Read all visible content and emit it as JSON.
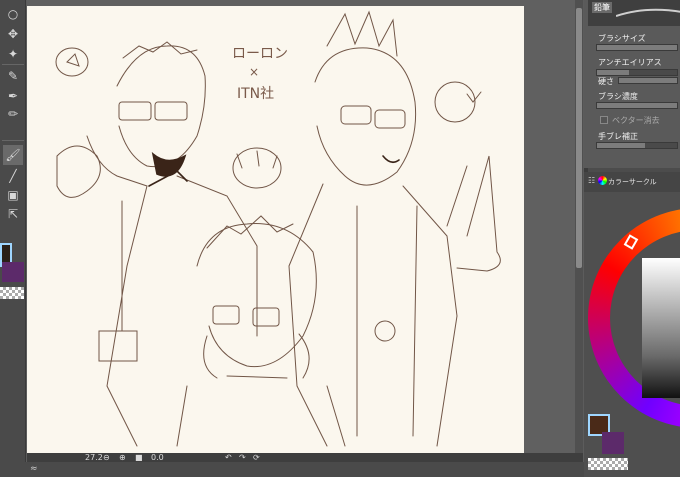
{
  "toolbar": {
    "tools": [
      {
        "name": "zoom-tool",
        "icon": "○"
      },
      {
        "name": "move-tool",
        "icon": "✥"
      },
      {
        "name": "select-tool",
        "icon": "✦"
      },
      {
        "name": "eyedropper-tool",
        "icon": "✎"
      },
      {
        "name": "pen-tool",
        "icon": "✒"
      },
      {
        "name": "pencil-tool",
        "icon": "✏"
      },
      {
        "name": "brush-tool",
        "icon": "🖌"
      },
      {
        "name": "line-tool",
        "icon": "╱"
      },
      {
        "name": "frame-tool",
        "icon": "▣"
      },
      {
        "name": "text-tool",
        "icon": "⇱"
      }
    ],
    "main_color": "#2a2018",
    "sub_color": "#5c2a6a"
  },
  "status": {
    "zoom": "27.2",
    "angle": "0.0"
  },
  "brush_panel": {
    "tab": "鉛筆",
    "size_label": "ブラシサイズ",
    "aa_label": "アンチエイリアス",
    "hardness_label": "硬さ",
    "density_label": "ブラシ濃度",
    "vector_erase_label": "ベクター消去",
    "stabilization_label": "手ブレ補正"
  },
  "color_panel": {
    "tab": "カラーサークル",
    "fg_color": "#4a2a18",
    "bg_color": "#5c2a6a"
  },
  "canvas": {
    "sketch_text_1": "ローロン",
    "sketch_text_2": "×",
    "sketch_text_3": "ITN社"
  }
}
